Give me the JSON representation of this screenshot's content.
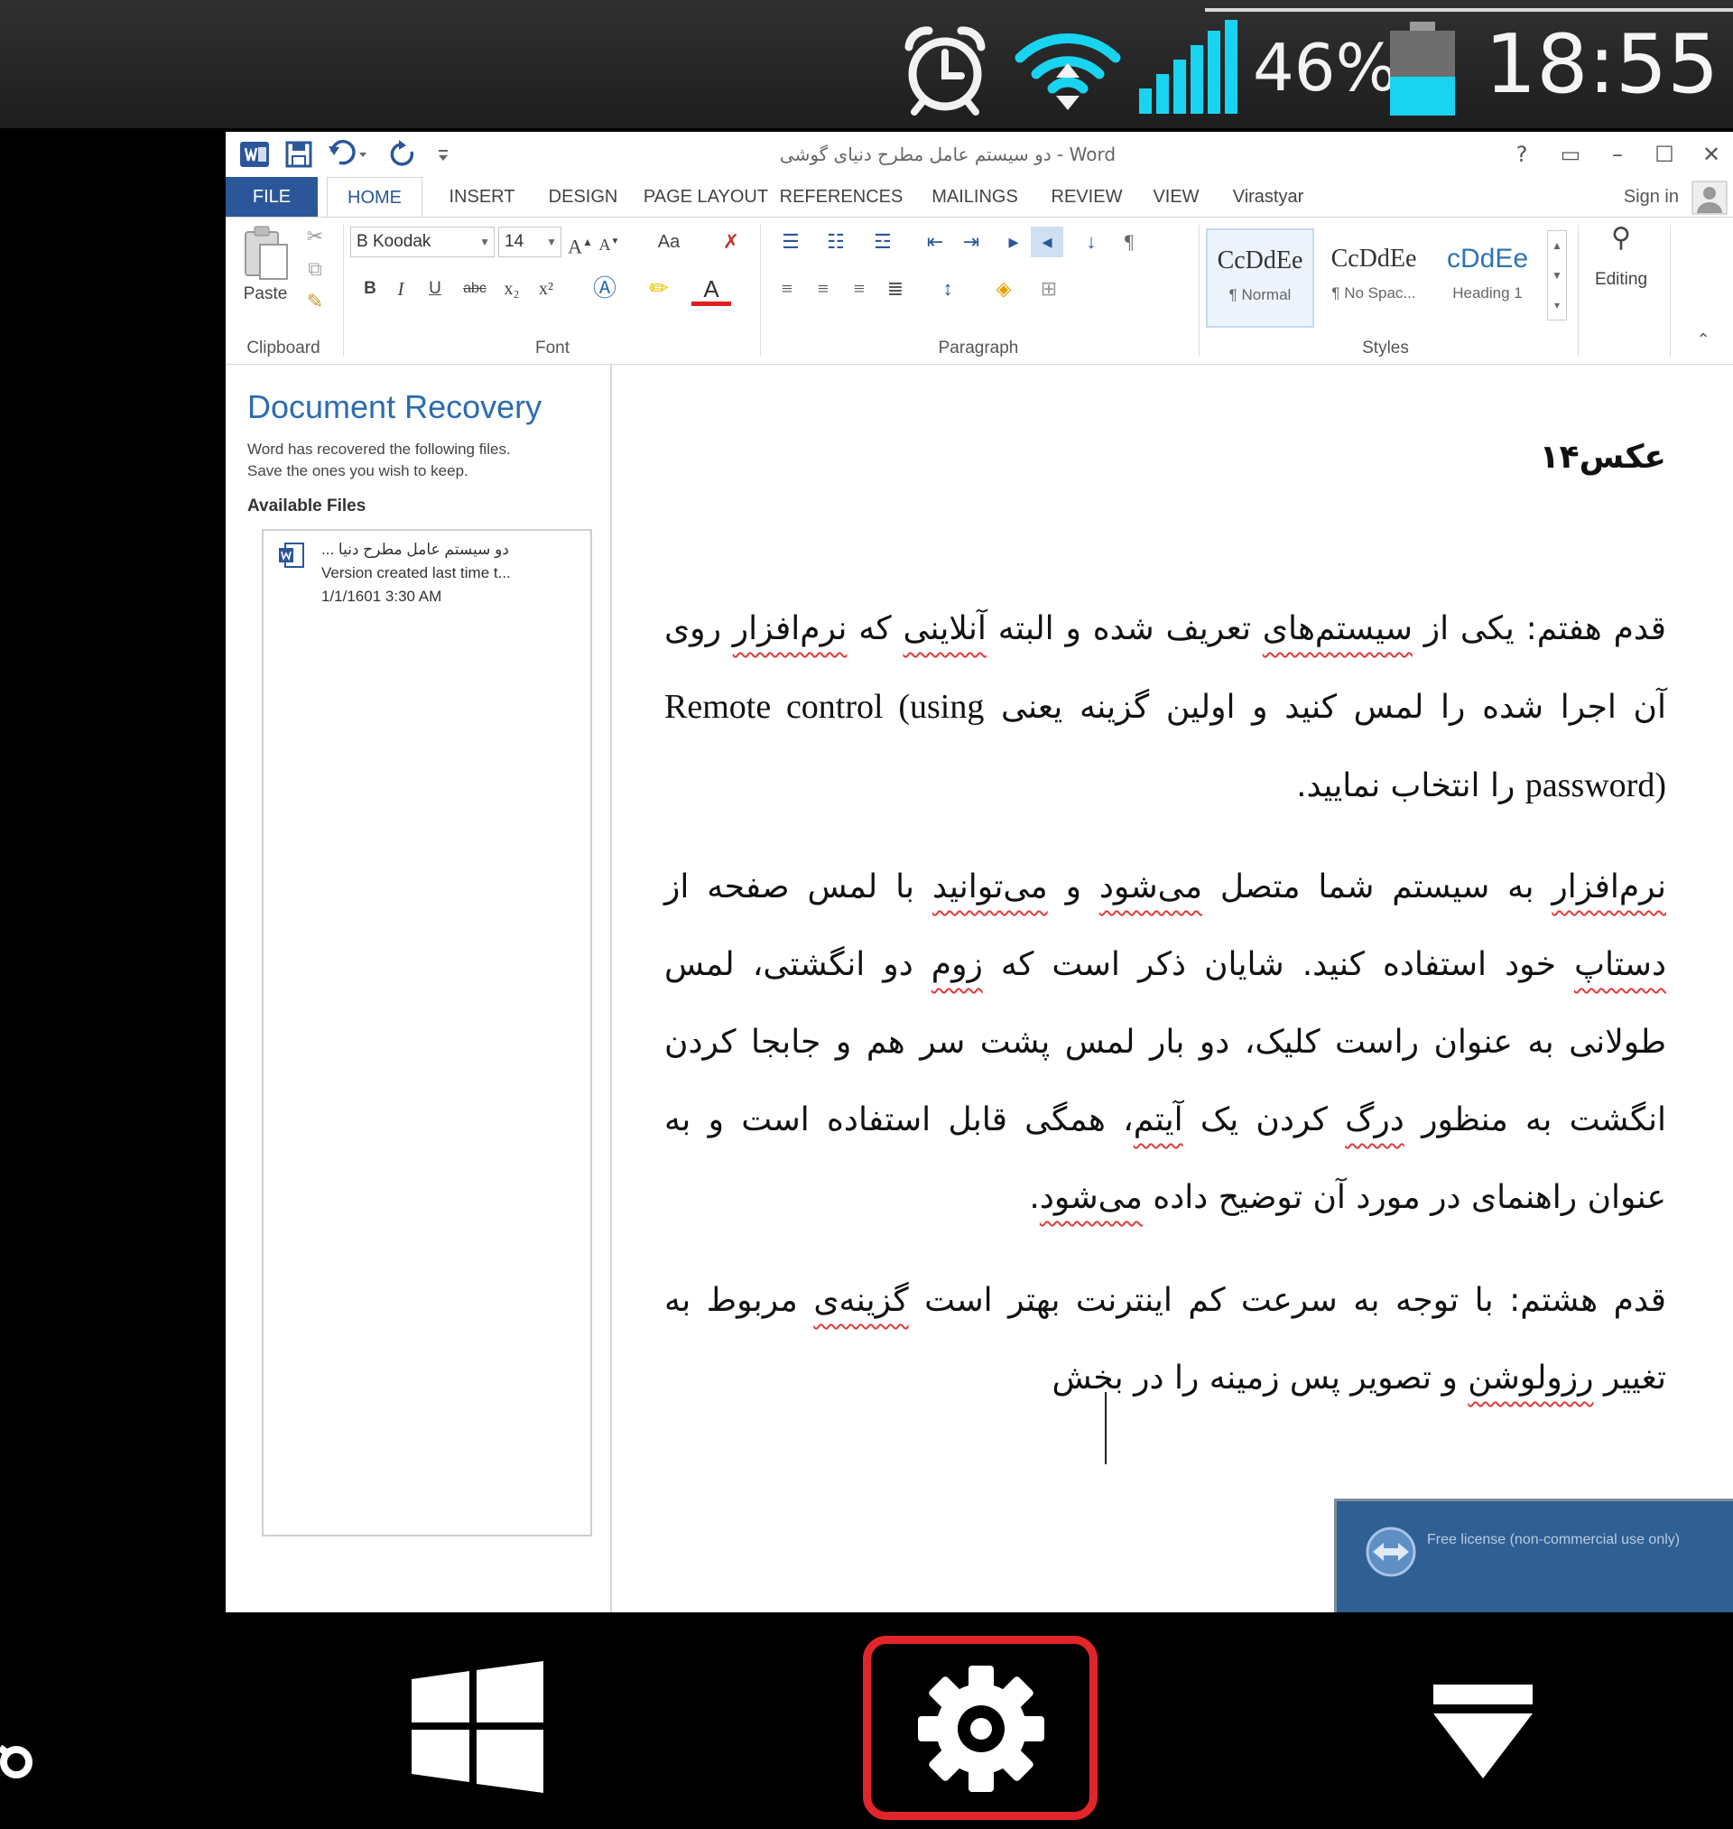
{
  "status_bar": {
    "battery_percent": "46%",
    "battery_level": 0.46,
    "time": "18:55",
    "icons": [
      "alarm-clock-icon",
      "wifi-icon",
      "signal-icon",
      "battery-icon"
    ],
    "colors": {
      "accent": "#19d4f0",
      "bar": "#2a2a2a"
    }
  },
  "word": {
    "title": "دو سیستم عامل مطرح دنیای گوشی - Word",
    "tabs": [
      "FILE",
      "HOME",
      "INSERT",
      "DESIGN",
      "PAGE LAYOUT",
      "REFERENCES",
      "MAILINGS",
      "REVIEW",
      "VIEW",
      "Virastyar"
    ],
    "active_tab": "HOME",
    "sign_in": "Sign in",
    "ribbon": {
      "clipboard": {
        "label": "Clipboard",
        "paste": "Paste"
      },
      "font": {
        "label": "Font",
        "font_name": "B Koodak",
        "font_size": "14",
        "change_case": "Aa",
        "buttons": [
          "B",
          "I",
          "U",
          "abc",
          "x₂",
          "x²"
        ]
      },
      "paragraph": {
        "label": "Paragraph"
      },
      "styles": {
        "label": "Styles",
        "items": [
          {
            "sample": "CcDdEe",
            "name": "¶ Normal"
          },
          {
            "sample": "CcDdEe",
            "name": "¶ No Spac..."
          },
          {
            "sample": "cDdEe",
            "name": "Heading 1"
          }
        ]
      },
      "editing": {
        "label": "Editing"
      }
    },
    "recovery": {
      "title": "Document Recovery",
      "desc_line1": "Word has recovered the following files.",
      "desc_line2": "Save the ones you wish to keep.",
      "available_label": "Available Files",
      "file": {
        "name": "دو سیستم عامل مطرح دنیا ...",
        "version": "Version created last time t...",
        "date": "1/1/1601 3:30 AM"
      }
    },
    "document": {
      "heading": "عکس۱۴",
      "p1": {
        "a": "قدم هفتم: یکی از ",
        "u1": "سیستم‌های",
        "b": " تعریف شده و البته ",
        "u2": "آنلاینی",
        "c": " که ",
        "u3": "نرم‌افزار",
        "d": " روی آن اجرا شده را لمس کنید و اولین گزینه یعنی ",
        "en": "Remote control (using password)",
        "e": " را انتخاب نمایید."
      },
      "p2": {
        "u1": "نرم‌افزار",
        "a": " به سیستم شما متصل ",
        "u2": "می‌شود",
        "b": " و ",
        "u3": "می‌توانید",
        "c": " با لمس صفحه از ",
        "u4": "دستاپ",
        "d": " خود استفاده کنید. شایان ذکر است که ",
        "u5": "زوم",
        "e": " دو انگشتی، لمس طولانی به عنوان راست کلیک، دو بار لمس پشت سر هم و جابجا کردن انگشت به منظور ",
        "u6": "درگ",
        "f": " کردن یک ",
        "u7": "آیتم",
        "g": "، همگی قابل استفاده است و به عنوان راهنمای در مورد آن توضیح داده ",
        "u8": "می‌شود",
        "h": "."
      },
      "p3": {
        "a": "قدم هشتم: با توجه به سرعت کم اینترنت بهتر است ",
        "u1": "گزینه‌ی",
        "b": " مربوط به تغییر ",
        "u2": "رزولوشن",
        "c": " و تصویر پس زمینه را در بخش"
      }
    },
    "popup_text": "Free license (non-commercial use only)"
  },
  "bottom_bar": {
    "buttons": [
      "windows-icon",
      "settings-gear-icon",
      "drop-down-icon"
    ],
    "highlight_color": "#e1252a"
  }
}
